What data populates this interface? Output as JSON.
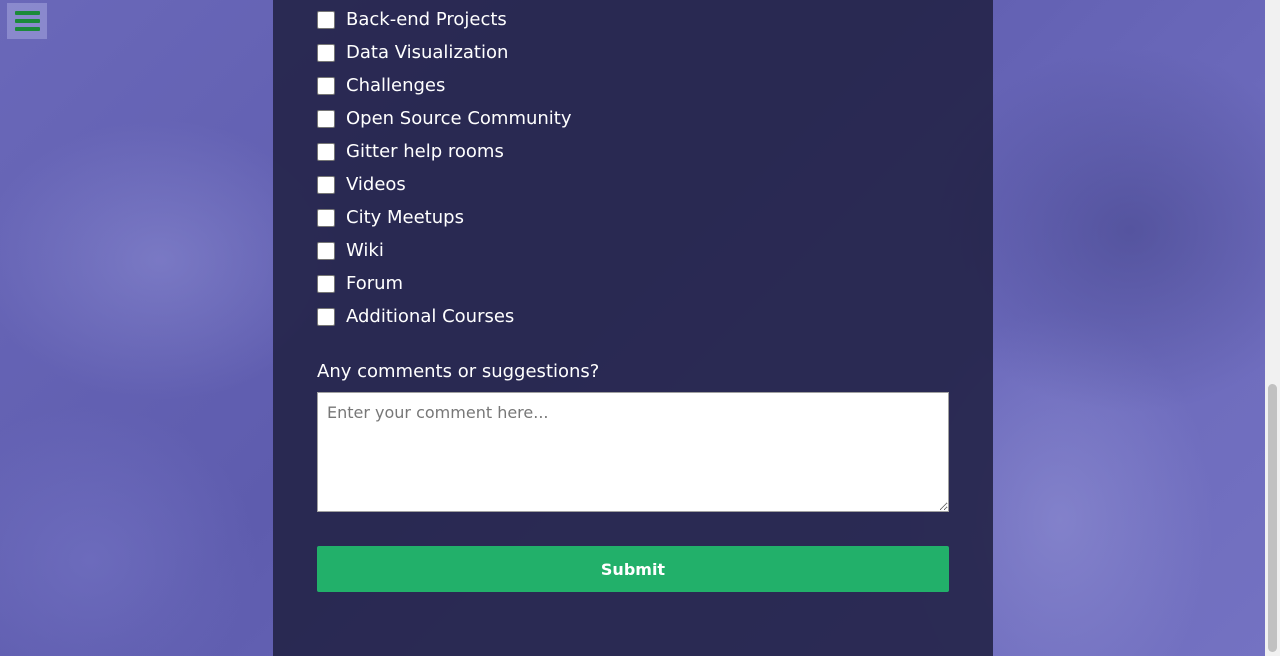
{
  "nav": {
    "menu_icon": "hamburger-menu-icon",
    "menu_color": "#1c8a3a"
  },
  "form": {
    "options": [
      {
        "label": "Back-end Projects",
        "checked": false
      },
      {
        "label": "Data Visualization",
        "checked": false
      },
      {
        "label": "Challenges",
        "checked": false
      },
      {
        "label": "Open Source Community",
        "checked": false
      },
      {
        "label": "Gitter help rooms",
        "checked": false
      },
      {
        "label": "Videos",
        "checked": false
      },
      {
        "label": "City Meetups",
        "checked": false
      },
      {
        "label": "Wiki",
        "checked": false
      },
      {
        "label": "Forum",
        "checked": false
      },
      {
        "label": "Additional Courses",
        "checked": false
      }
    ],
    "comments_label": "Any comments or suggestions?",
    "comments_placeholder": "Enter your comment here...",
    "comments_value": "",
    "submit_label": "Submit"
  },
  "colors": {
    "panel_bg": "#242448",
    "submit_bg": "#22b06a",
    "text": "#ffffff"
  }
}
